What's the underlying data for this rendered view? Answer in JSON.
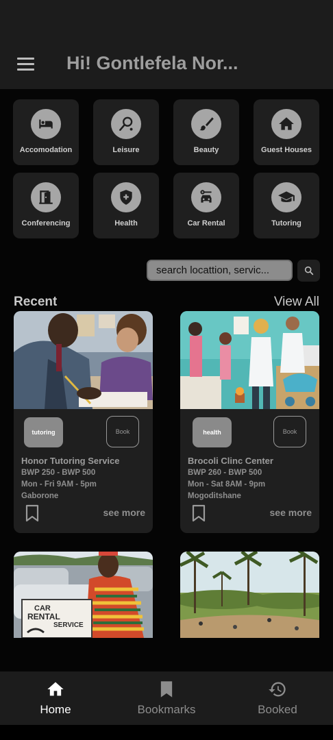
{
  "header": {
    "greeting": "Hi! Gontlefela Nor..."
  },
  "categories": [
    {
      "label": "Accomodation",
      "icon": "bed-icon"
    },
    {
      "label": "Leisure",
      "icon": "leisure-icon"
    },
    {
      "label": "Beauty",
      "icon": "brush-icon"
    },
    {
      "label": "Guest Houses",
      "icon": "house-icon"
    },
    {
      "label": "Conferencing",
      "icon": "door-icon"
    },
    {
      "label": "Health",
      "icon": "health-shield-icon"
    },
    {
      "label": "Car Rental",
      "icon": "car-icon"
    },
    {
      "label": "Tutoring",
      "icon": "graduation-cap-icon"
    }
  ],
  "search": {
    "value": "search locattion, servic..."
  },
  "recent": {
    "title": "Recent",
    "view_all": "View All"
  },
  "cards": [
    {
      "tag": "tutoring",
      "book": "Book",
      "name": "Honor Tutoring Service",
      "price": "BWP 250 - BWP 500",
      "hours": "Mon - Fri 9AM - 5pm",
      "location": "Gaborone",
      "see_more": "see more"
    },
    {
      "tag": "health",
      "book": "Book",
      "name": "Brocoli Clinc Center",
      "price": "BWP 260 - BWP 500",
      "hours": "Mon - Sat 8AM - 9pm",
      "location": "Mogoditshane",
      "see_more": "see more"
    }
  ],
  "car_sign": {
    "line1": "CAR",
    "line2": "RENTAL",
    "line3": "SERVICE"
  },
  "nav": [
    {
      "label": "Home",
      "icon": "home-icon",
      "active": true
    },
    {
      "label": "Bookmarks",
      "icon": "bookmark-icon",
      "active": false
    },
    {
      "label": "Booked",
      "icon": "history-icon",
      "active": false
    }
  ],
  "colors": {
    "background": "#050505",
    "surface": "#1f1f1f",
    "icon_circle": "#a6a6a6",
    "active_nav": "#ffffff"
  }
}
